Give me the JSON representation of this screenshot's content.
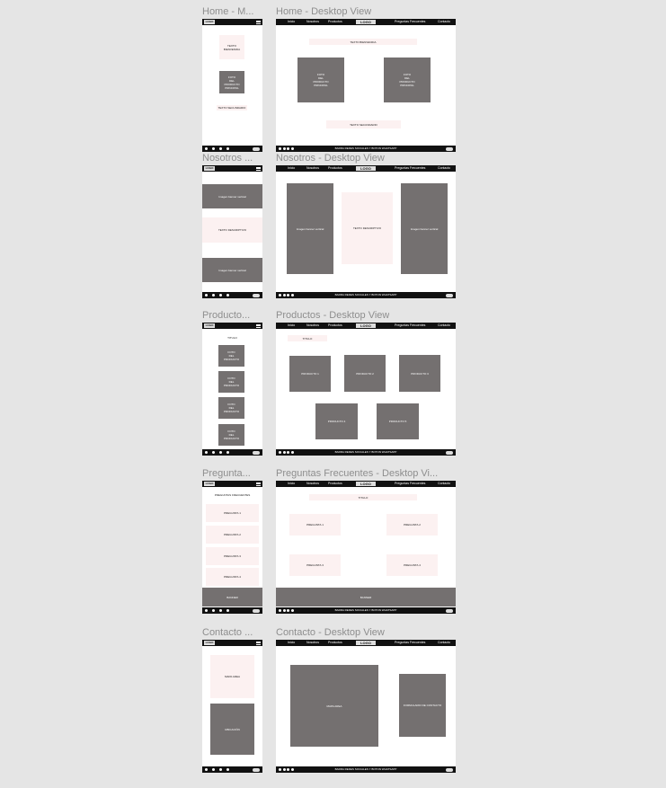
{
  "frames": {
    "home_mobile": "Home - M...",
    "home_desktop": "Home - Desktop View",
    "nosotros_mobile": "Nosotros ...",
    "nosotros_desktop": "Nosotros - Desktop View",
    "productos_mobile": "Producto...",
    "productos_desktop": "Productos - Desktop View",
    "preguntas_mobile": "Pregunta...",
    "preguntas_desktop": "Preguntas Frecuentes - Desktop Vi...",
    "contacto_mobile": "Contacto ...",
    "contacto_desktop": "Contacto - Desktop View"
  },
  "common": {
    "logo": "LOGO",
    "nav": [
      "Inicio",
      "Nosotros",
      "Productos",
      "Preguntas Frecuentes",
      "Contacto"
    ],
    "footer": "BARRA REDES SOCIALES Y BOTON WHATSAPP"
  },
  "home": {
    "texto_bienvenida": "TEXTO BIENVENIDA",
    "foto_producto": "FOTO\nDEL\nPRODUCTO\nPRINCIPAL",
    "texto_secundario": "TEXTO SECUNDARIO"
  },
  "nosotros": {
    "imagen_vertical": "Imagen banner vertical",
    "texto_descriptivo": "TEXTO DESCRIPTIVO"
  },
  "productos": {
    "titulo": "TITULO",
    "foto_producto": "FOTO\nDEL\nPRODUCTO",
    "items": [
      "PRODUCTO 1",
      "PRODUCTO 2",
      "PRODUCTO 3",
      "PRODUCTO 4",
      "PRODUCTO 5"
    ]
  },
  "preguntas": {
    "titulo_mobile": "PREGUNTAS FRECUENTES",
    "titulo_desktop": "TITULO",
    "items": [
      "PREGUNTA 1",
      "PREGUNTA 2",
      "PREGUNTA 3",
      "PREGUNTA 4"
    ],
    "banner": "BANNER"
  },
  "contacto": {
    "mapa": "MAPA AREA",
    "ubicacion": "UBICACIÓN",
    "formulario": "FORMULARIO DE CONTACTO"
  },
  "colors": {
    "dark_box": "#747070",
    "pink_box": "#fcf1f1",
    "bar": "#111111",
    "canvas": "#e5e5e5"
  }
}
